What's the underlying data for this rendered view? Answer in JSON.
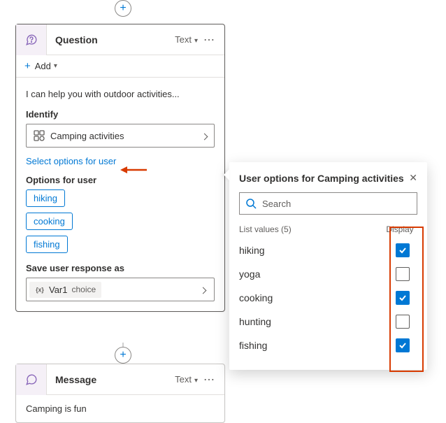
{
  "question": {
    "title": "Question",
    "kindLabel": "Text",
    "addLabel": "Add",
    "prompt": "I can help you with outdoor activities...",
    "identifyLabel": "Identify",
    "identifyValue": "Camping activities",
    "selectOptionsLink": "Select options for user",
    "optionsForUserLabel": "Options for user",
    "chips": [
      "hiking",
      "cooking",
      "fishing"
    ],
    "saveLabel": "Save user response as",
    "varName": "Var1",
    "varType": "choice"
  },
  "message": {
    "title": "Message",
    "kindLabel": "Text",
    "body": "Camping is fun"
  },
  "popover": {
    "title": "User options for Camping activities",
    "searchPlaceholder": "Search",
    "listValuesLabel": "List values (5)",
    "displayLabel": "Display",
    "items": [
      {
        "label": "hiking",
        "checked": true
      },
      {
        "label": "yoga",
        "checked": false
      },
      {
        "label": "cooking",
        "checked": true
      },
      {
        "label": "hunting",
        "checked": false
      },
      {
        "label": "fishing",
        "checked": true
      }
    ]
  }
}
